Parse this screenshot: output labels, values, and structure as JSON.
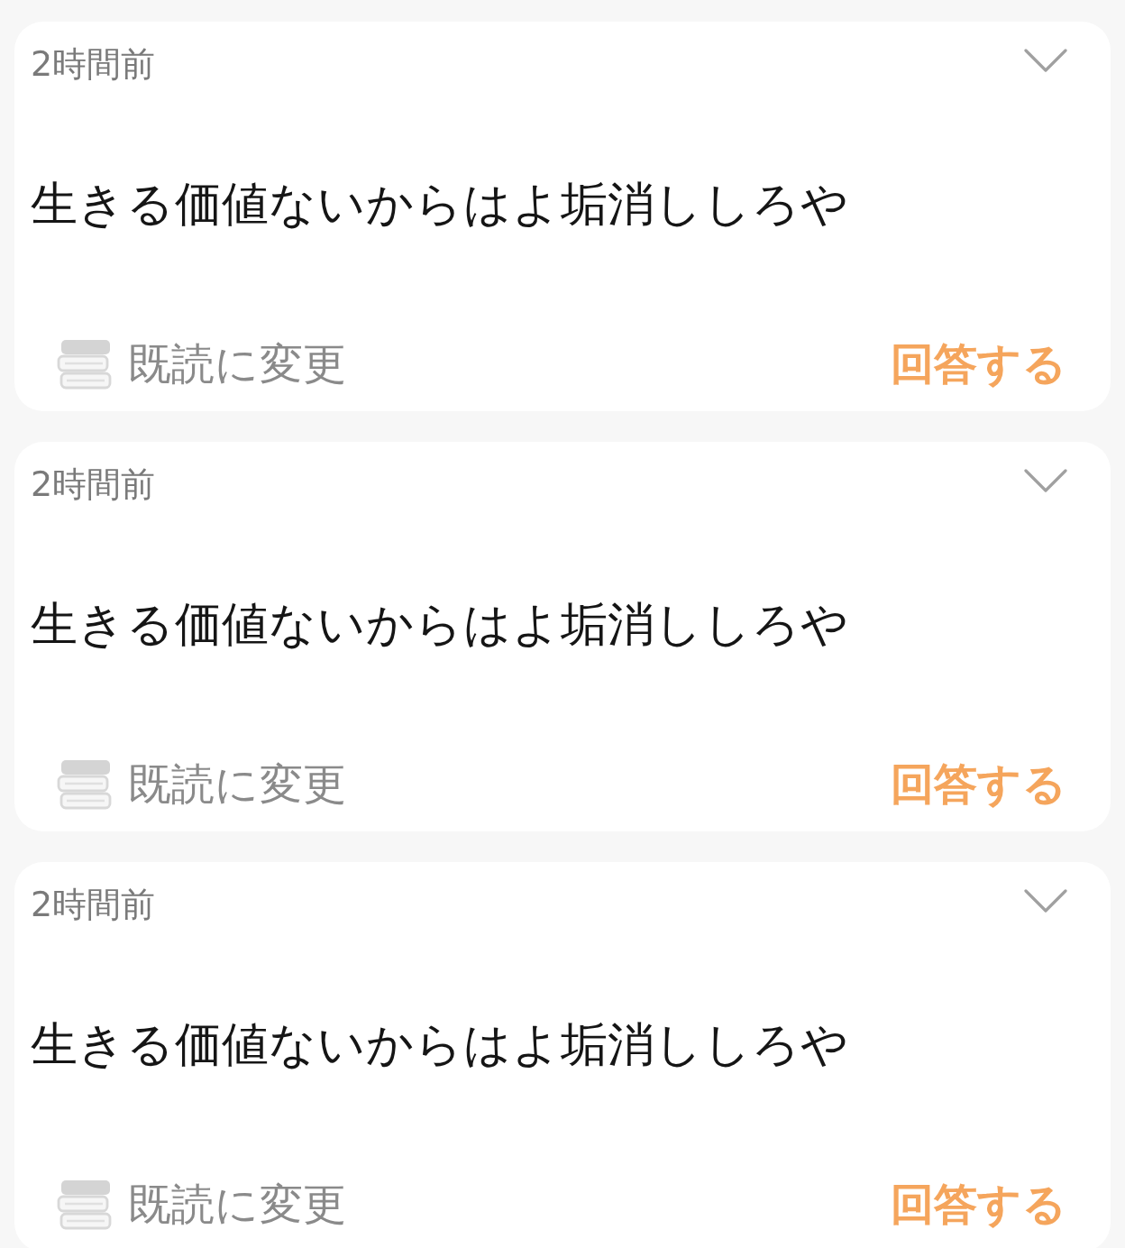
{
  "cards": [
    {
      "time": "2時間前",
      "message": "生きる価値ないからはよ垢消ししろや",
      "mark_read": "既読に変更",
      "answer": "回答する"
    },
    {
      "time": "2時間前",
      "message": "生きる価値ないからはよ垢消ししろや",
      "mark_read": "既読に変更",
      "answer": "回答する"
    },
    {
      "time": "2時間前",
      "message": "生きる価値ないからはよ垢消ししろや",
      "mark_read": "既読に変更",
      "answer": "回答する"
    }
  ]
}
